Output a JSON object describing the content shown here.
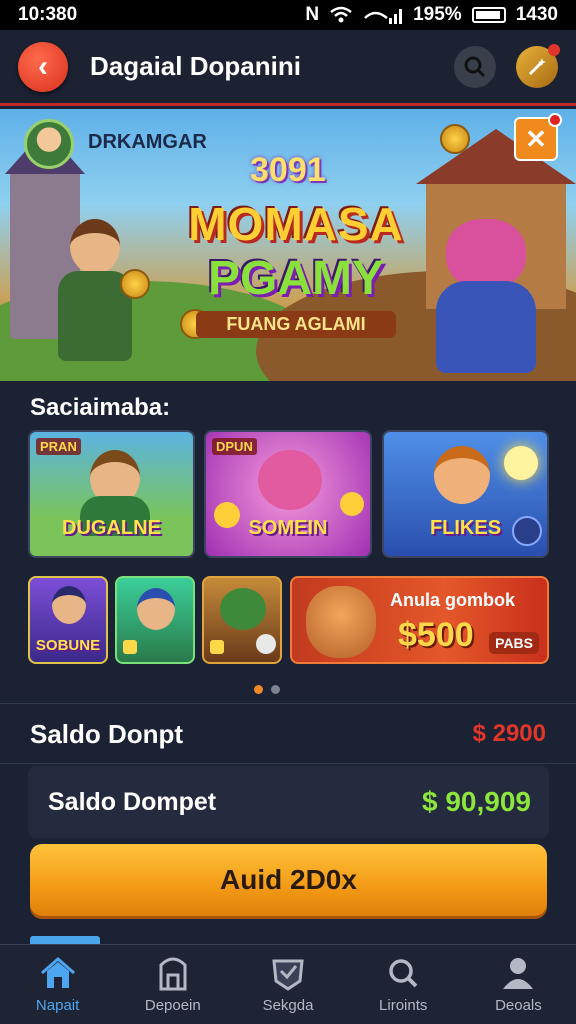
{
  "status_bar": {
    "time": "10:380",
    "network": "N",
    "battery_pct": "195%",
    "clock_right": "1430"
  },
  "header": {
    "title": "Dagaial Dopanini"
  },
  "banner": {
    "user_name": "DRKAMGAR",
    "game_number": "3091",
    "title_line1": "MOMASA",
    "title_line2": "PGAMY",
    "subtitle": "FUANG AGLAMI"
  },
  "section": {
    "title": "Saciaimaba:"
  },
  "games": [
    {
      "tag": "PRAN",
      "label": "DUGALNE"
    },
    {
      "tag": "DPUN",
      "label": "SOMEIN"
    },
    {
      "tag": "",
      "label": "FLIKES"
    }
  ],
  "small_games": [
    {
      "label": "SOBUNE"
    },
    {
      "label": ""
    },
    {
      "label": ""
    }
  ],
  "promo": {
    "line1": "Anula gombok",
    "amount": "$500",
    "pill": "PABS"
  },
  "carousel": {
    "dots": 2,
    "active": 0
  },
  "saldo_row": {
    "label": "Saldo Donpt",
    "value": "$ 2900"
  },
  "wallet": {
    "label": "Saldo Dompet",
    "value": "$ 90,909"
  },
  "cta": {
    "label": "Auid 2D0x"
  },
  "bottom_nav": [
    {
      "label": "Napait",
      "icon": "home-icon",
      "active": true
    },
    {
      "label": "Depoein",
      "icon": "deposit-icon",
      "active": false
    },
    {
      "label": "Sekgda",
      "icon": "shield-icon",
      "active": false
    },
    {
      "label": "Liroints",
      "icon": "search-icon",
      "active": false
    },
    {
      "label": "Deoals",
      "icon": "user-icon",
      "active": false
    }
  ],
  "colors": {
    "accent": "#f39a16",
    "danger": "#e2362a",
    "positive": "#8ce63c",
    "nav_active": "#4ea5f0"
  }
}
